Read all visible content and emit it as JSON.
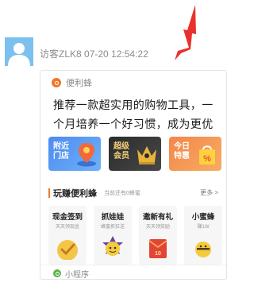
{
  "message": {
    "sender": "访客ZLK8",
    "timestamp": "07-20 12:54:22",
    "avatar_icon": "default-user-avatar-icon",
    "avatar_color": "#7cc0ef"
  },
  "annotation": {
    "arrow_color": "#e8312c"
  },
  "card": {
    "app_name": "便利蜂",
    "app_icon": "bianlifeng-logo-icon",
    "accent": "#f0792a",
    "description": "推荐一款超实用的购物工具，一个月培养一个好习惯，成为更优秀...",
    "tiles": [
      {
        "label": "附近门店",
        "color": "#4c8bf0"
      },
      {
        "label": "超级会员",
        "color": "#2c2c2c"
      },
      {
        "label": "今日特惠",
        "color": "#f38649"
      }
    ],
    "section": {
      "title": "玩赚便利蜂",
      "subtitle": "当前还有0蜂蜜",
      "more": "更多 >"
    },
    "activities": [
      {
        "title": "现金签到",
        "subtitle": "天天领现金"
      },
      {
        "title": "抓娃娃",
        "subtitle": "蜂蜜抓狂送"
      },
      {
        "title": "邀新有礼",
        "subtitle": "天天领奖励"
      },
      {
        "title": "小蜜蜂",
        "subtitle": "赚1W"
      }
    ],
    "footer": {
      "label": "小程序",
      "icon": "mini-program-icon",
      "color": "#59b34a"
    }
  }
}
